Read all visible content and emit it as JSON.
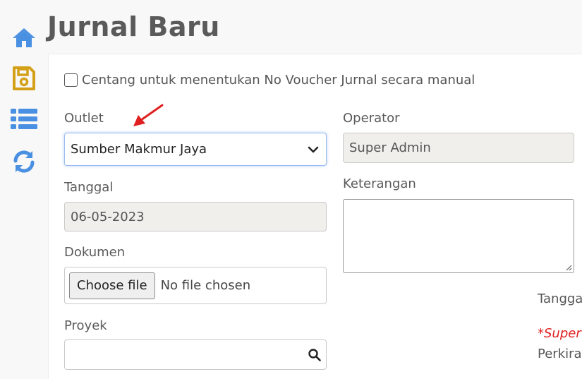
{
  "sidebar": {
    "icons": [
      "home-icon",
      "save-icon",
      "list-icon",
      "refresh-icon"
    ],
    "accent": "#4a90e2",
    "save_color": "#d4a017"
  },
  "page": {
    "title": "Jurnal Baru"
  },
  "form": {
    "manual_voucher_label": "Centang untuk menentukan No Voucher Jurnal secara manual",
    "outlet": {
      "label": "Outlet",
      "value": "Sumber Makmur Jaya"
    },
    "operator": {
      "label": "Operator",
      "value": "Super Admin"
    },
    "tanggal": {
      "label": "Tanggal",
      "value": "06-05-2023"
    },
    "keterangan": {
      "label": "Keterangan",
      "value": ""
    },
    "dokumen": {
      "label": "Dokumen",
      "button": "Choose file",
      "status": "No file chosen"
    },
    "proyek": {
      "label": "Proyek",
      "value": ""
    }
  },
  "right_panel": {
    "tanggal_partial": "Tangga",
    "note_partial": "*Super A",
    "perkiraan_partial": "Perkiraa"
  },
  "annotation": {
    "arrow_color": "#e02020"
  }
}
